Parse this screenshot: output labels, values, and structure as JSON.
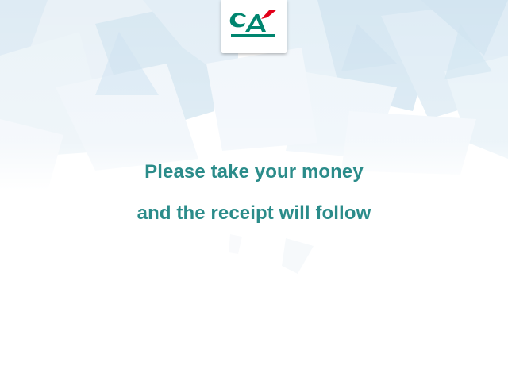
{
  "brand": {
    "logo_name": "credit-agricole-logo",
    "colors": {
      "green": "#00856f",
      "red": "#e2001a",
      "message": "#2b8c8a"
    }
  },
  "message": {
    "line1": "Please take your money",
    "line2": "and the receipt will follow"
  }
}
